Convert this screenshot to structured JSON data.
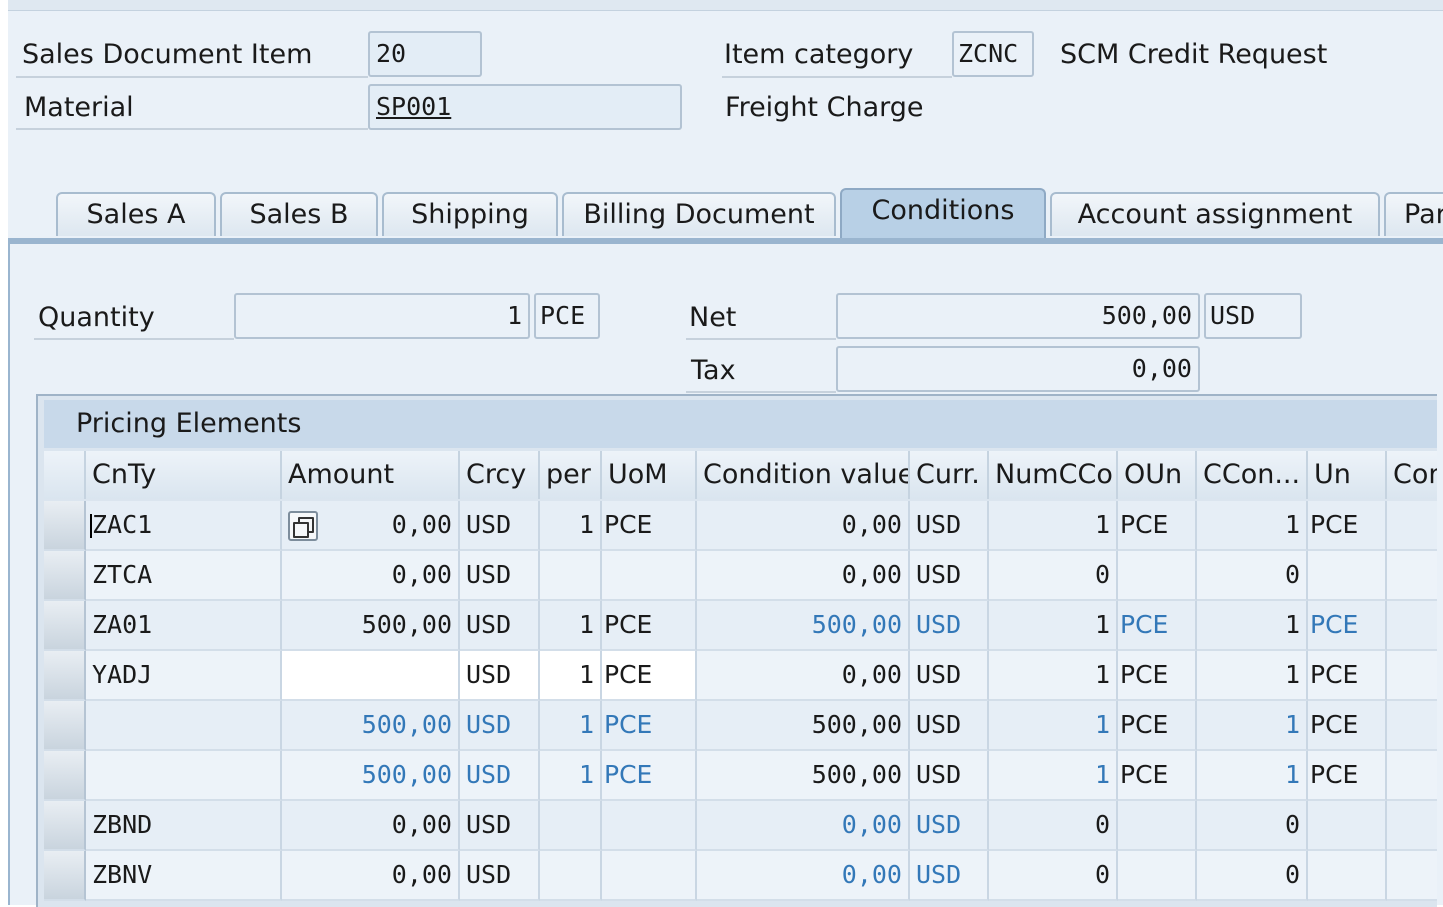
{
  "header": {
    "sales_doc_item_label": "Sales Document Item",
    "sales_doc_item_value": "20",
    "material_label": "Material",
    "material_value": "SP001",
    "item_category_label": "Item category",
    "item_category_value": "ZCNC",
    "item_category_desc": "SCM Credit Request",
    "material_desc": "Freight Charge"
  },
  "tabs": [
    {
      "label": "Sales A"
    },
    {
      "label": "Sales B"
    },
    {
      "label": "Shipping"
    },
    {
      "label": "Billing Document"
    },
    {
      "label": "Conditions",
      "active": true
    },
    {
      "label": "Account assignment"
    },
    {
      "label": "Par"
    }
  ],
  "conditions": {
    "quantity_label": "Quantity",
    "quantity_value": "1",
    "quantity_unit": "PCE",
    "net_label": "Net",
    "net_value": "500,00",
    "net_currency": "USD",
    "tax_label": "Tax",
    "tax_value": "0,00"
  },
  "pricing": {
    "title": "Pricing Elements",
    "columns": [
      "CnTy",
      "Amount",
      "Crcy",
      "per",
      "UoM",
      "Condition value",
      "Curr.",
      "NumCCo",
      "OUn",
      "CCon...",
      "Un",
      "Con"
    ],
    "rows": [
      {
        "cnty": "ZAC1",
        "amount": "0,00",
        "crcy": "USD",
        "per": "1",
        "uom": "PCE",
        "value": "0,00",
        "curr": "USD",
        "numcco": "1",
        "oun": "PCE",
        "ccon": "1",
        "un": "PCE"
      },
      {
        "cnty": "ZTCA",
        "amount": "0,00",
        "crcy": "USD",
        "per": "",
        "uom": "",
        "value": "0,00",
        "curr": "USD",
        "numcco": "0",
        "oun": "",
        "ccon": "0",
        "un": ""
      },
      {
        "cnty": "ZA01",
        "amount": "500,00",
        "crcy": "USD",
        "per": "1",
        "uom": "PCE",
        "value": "500,00",
        "curr": "USD",
        "numcco": "1",
        "oun": "PCE",
        "ccon": "1",
        "un": "PCE"
      },
      {
        "cnty": "YADJ",
        "amount": "",
        "crcy": "USD",
        "per": "1",
        "uom": "PCE",
        "value": "0,00",
        "curr": "USD",
        "numcco": "1",
        "oun": "PCE",
        "ccon": "1",
        "un": "PCE"
      },
      {
        "cnty": "",
        "amount": "500,00",
        "crcy": "USD",
        "per": "1",
        "uom": "PCE",
        "value": "500,00",
        "curr": "USD",
        "numcco": "1",
        "oun": "PCE",
        "ccon": "1",
        "un": "PCE"
      },
      {
        "cnty": "",
        "amount": "500,00",
        "crcy": "USD",
        "per": "1",
        "uom": "PCE",
        "value": "500,00",
        "curr": "USD",
        "numcco": "1",
        "oun": "PCE",
        "ccon": "1",
        "un": "PCE"
      },
      {
        "cnty": "ZBND",
        "amount": "0,00",
        "crcy": "USD",
        "per": "",
        "uom": "",
        "value": "0,00",
        "curr": "USD",
        "numcco": "0",
        "oun": "",
        "ccon": "0",
        "un": ""
      },
      {
        "cnty": "ZBNV",
        "amount": "0,00",
        "crcy": "USD",
        "per": "",
        "uom": "",
        "value": "0,00",
        "curr": "USD",
        "numcco": "0",
        "oun": "",
        "ccon": "0",
        "un": ""
      }
    ]
  },
  "colors": {
    "link_blue": "#3378b8",
    "active_tab": "#b8d0e6",
    "background": "#eaf1f8"
  },
  "icons": {
    "value_help": "value-help-icon"
  }
}
